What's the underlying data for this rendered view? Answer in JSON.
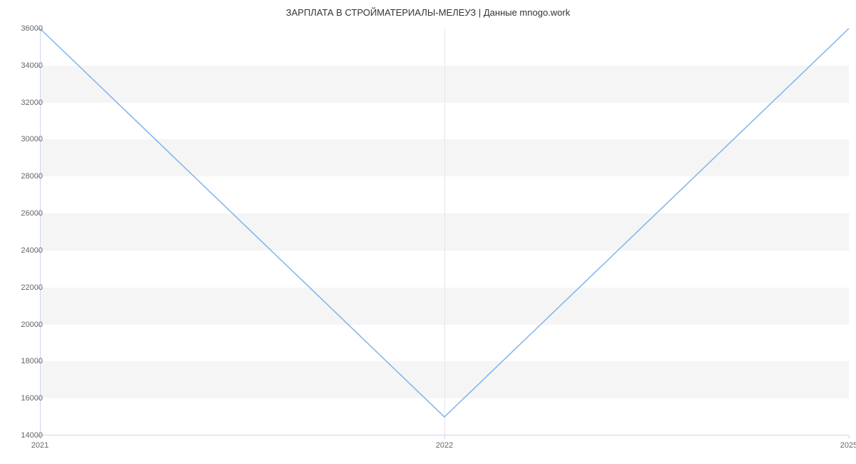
{
  "chart_data": {
    "type": "line",
    "title": "ЗАРПЛАТА В  СТРОЙМАТЕРИАЛЫ-МЕЛЕУЗ | Данные mnogo.work",
    "x_categories": [
      "2021",
      "2022",
      "2025"
    ],
    "x_positions": [
      0,
      0.5,
      1
    ],
    "values": [
      36000,
      15000,
      36000
    ],
    "ylim": [
      14000,
      36000
    ],
    "y_ticks": [
      14000,
      16000,
      18000,
      20000,
      22000,
      24000,
      26000,
      28000,
      30000,
      32000,
      34000,
      36000
    ],
    "xlabel": "",
    "ylabel": "",
    "line_color": "#7cb5ec",
    "band_color": "#f5f5f5"
  }
}
